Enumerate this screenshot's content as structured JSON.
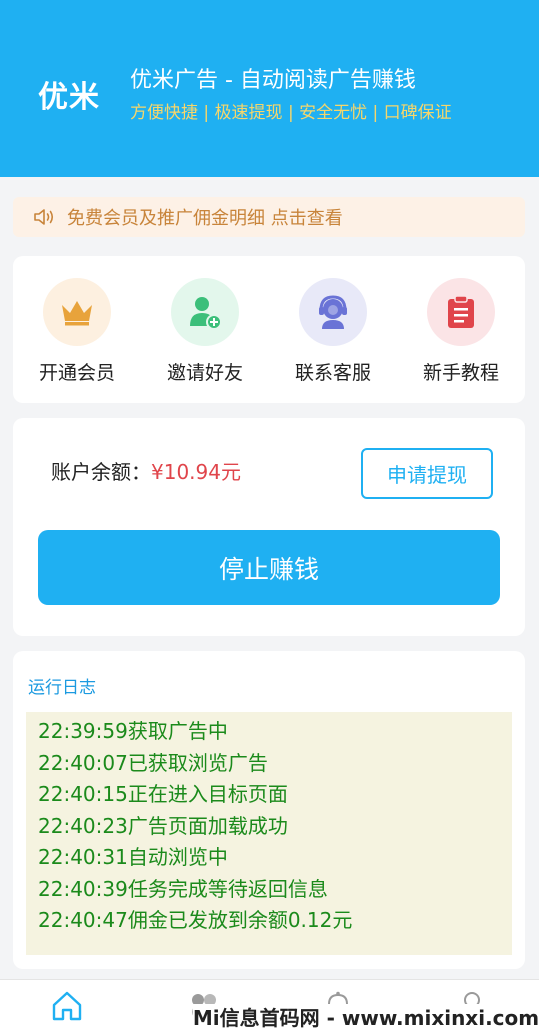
{
  "header": {
    "logo": "优米",
    "title": "优米广告 - 自动阅读广告赚钱",
    "subtitle": "方便快捷 | 极速提现 | 安全无忧 | 口碑保证"
  },
  "notice": {
    "icon": "speaker-icon",
    "text": "免费会员及推广佣金明细 点击查看"
  },
  "quick_actions": [
    {
      "label": "开通会员",
      "icon": "crown-icon",
      "color": "#e8a33b",
      "bg": "#fdf0e0"
    },
    {
      "label": "邀请好友",
      "icon": "add-user-icon",
      "color": "#3cbf7a",
      "bg": "#e3f7ec"
    },
    {
      "label": "联系客服",
      "icon": "customer-service-icon",
      "color": "#6a73d6",
      "bg": "#e8e9f8"
    },
    {
      "label": "新手教程",
      "icon": "clipboard-icon",
      "color": "#e0454b",
      "bg": "#fbe4e6"
    }
  ],
  "balance": {
    "label": "账户余额：",
    "value": "¥10.94元",
    "withdraw_label": "申请提现",
    "stop_label": "停止赚钱"
  },
  "log": {
    "title": "运行日志",
    "lines": [
      "22:39:59获取广告中",
      "22:40:07已获取浏览广告",
      "22:40:15正在进入目标页面",
      "22:40:23广告页面加载成功",
      "22:40:31自动浏览中",
      "22:40:39任务完成等待返回信息",
      "22:40:47佣金已发放到余额0.12元"
    ]
  },
  "tabbar": {
    "tabs": [
      {
        "icon": "home-icon",
        "active": true
      },
      {
        "icon": "apps-icon",
        "active": false
      },
      {
        "icon": "bell-icon",
        "active": false
      },
      {
        "icon": "user-icon",
        "active": false
      }
    ]
  },
  "watermark": "Mi信息首码网 - www.mixinxi.com",
  "colors": {
    "primary": "#1fb0f2",
    "accent_yellow": "#f6d66b",
    "price_red": "#e0454b",
    "log_green": "#1b8a1b"
  }
}
